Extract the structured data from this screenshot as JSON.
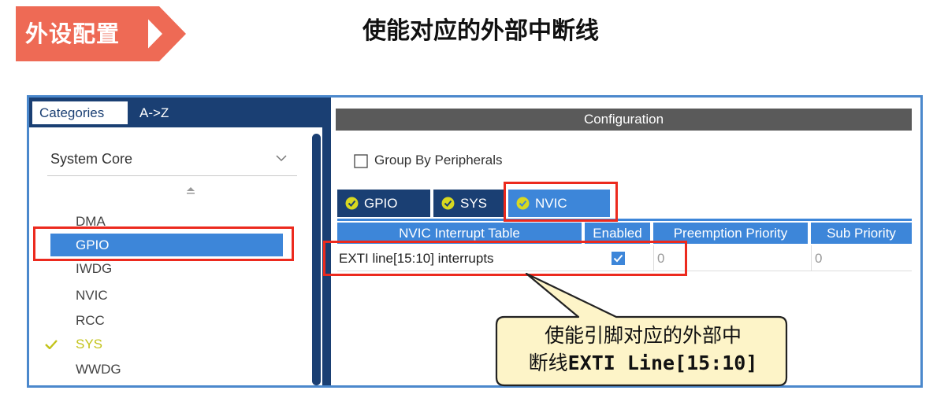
{
  "slide": {
    "section_tag": "外设配置",
    "title": "使能对应的外部中断线"
  },
  "left_pane": {
    "tabs": [
      "Categories",
      "A->Z"
    ],
    "category_select": "System Core",
    "items": [
      "DMA",
      "GPIO",
      "IWDG",
      "NVIC",
      "RCC",
      "SYS",
      "WWDG"
    ],
    "selected_item": "GPIO",
    "configured_item": "SYS"
  },
  "right_pane": {
    "header": "Configuration",
    "group_by_label": "Group By Peripherals",
    "group_by_checked": false,
    "tabs": [
      "GPIO",
      "SYS",
      "NVIC"
    ],
    "active_tab": "NVIC",
    "table": {
      "columns": [
        "NVIC Interrupt Table",
        "Enabled",
        "Preemption Priority",
        "Sub Priority"
      ],
      "rows": [
        {
          "name": "EXTI line[15:10] interrupts",
          "enabled": true,
          "preemption": "0",
          "sub": "0"
        }
      ]
    }
  },
  "callout": {
    "line1": "使能引脚对应的外部中",
    "line2_prefix": "断线",
    "line2_code": "EXTI Line[15:10]"
  },
  "colors": {
    "accent_red": "#ec2a1e",
    "tag_orange": "#ee6a55",
    "navy": "#1a3f73",
    "blue": "#3d86d9",
    "callout_fill": "#fdf4c8",
    "check_yellow": "#c3c31a"
  }
}
